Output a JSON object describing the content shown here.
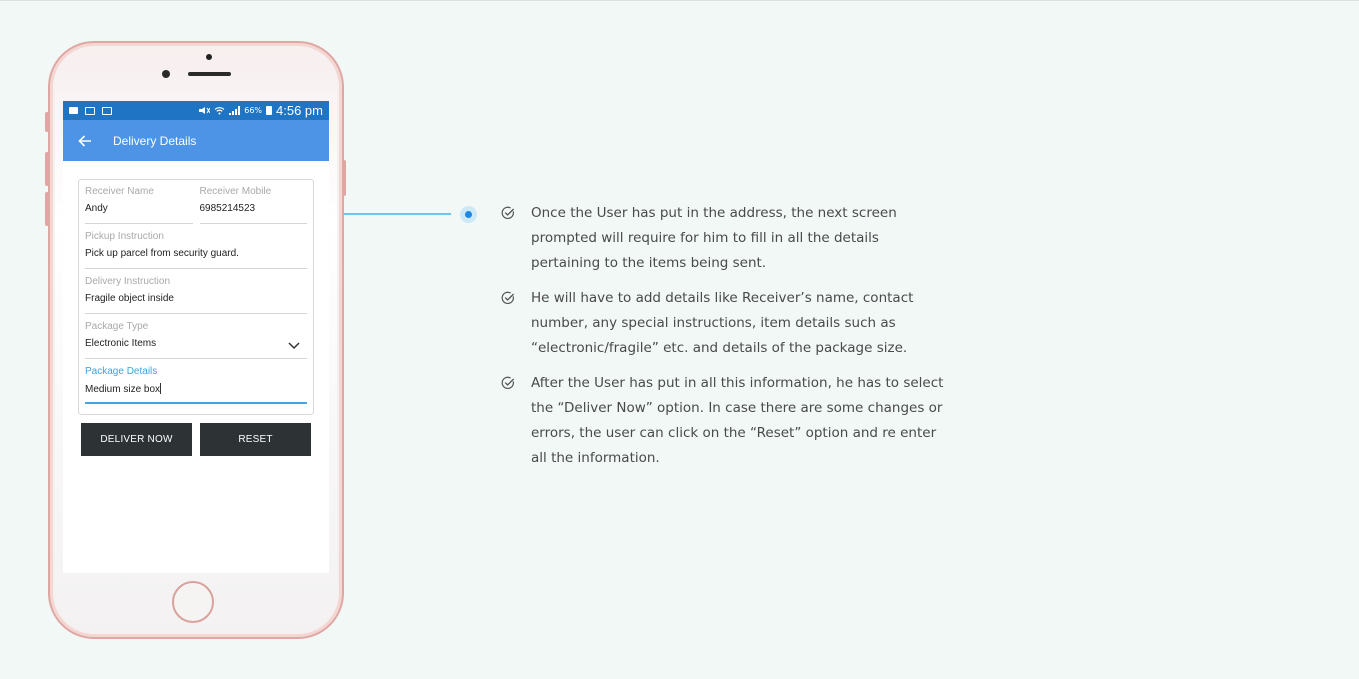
{
  "status_bar": {
    "battery_percent": "66%",
    "time": "4:56 pm"
  },
  "app_bar": {
    "title": "Delivery Details",
    "back_icon": "arrow-left-icon"
  },
  "form": {
    "receiver_name": {
      "label": "Receiver Name",
      "value": "Andy"
    },
    "receiver_mobile": {
      "label": "Receiver Mobile",
      "value": "6985214523"
    },
    "pickup_instruction": {
      "label": "Pickup Instruction",
      "value": "Pick up parcel from security guard."
    },
    "delivery_instruction": {
      "label": "Delivery Instruction",
      "value": "Fragile object inside"
    },
    "package_type": {
      "label": "Package Type",
      "value": "Electronic Items",
      "icon": "chevron-down-icon"
    },
    "package_details": {
      "label": "Package Details",
      "value": "Medium size box"
    }
  },
  "buttons": {
    "deliver_now": "DELIVER NOW",
    "reset": "RESET"
  },
  "points": [
    "Once the User has put in the address, the next screen prompted will require for him to fill in all the details pertaining to the items being sent.",
    "He will have to add details like Receiver’s name, contact number, any special instructions, item details such as “electronic/fragile” etc. and details of the package size.",
    "After the User has put in all this information, he has to select the “Deliver Now” option. In case there are some changes or errors, the user can click on the “Reset” option and re enter all the information."
  ],
  "colors": {
    "page_background": "#f1f8f6",
    "status_bar": "#1f74c4",
    "app_bar": "#4d93e6",
    "button": "#2d3235",
    "accent": "#43a0e0",
    "connector": "#6cc6ef"
  }
}
